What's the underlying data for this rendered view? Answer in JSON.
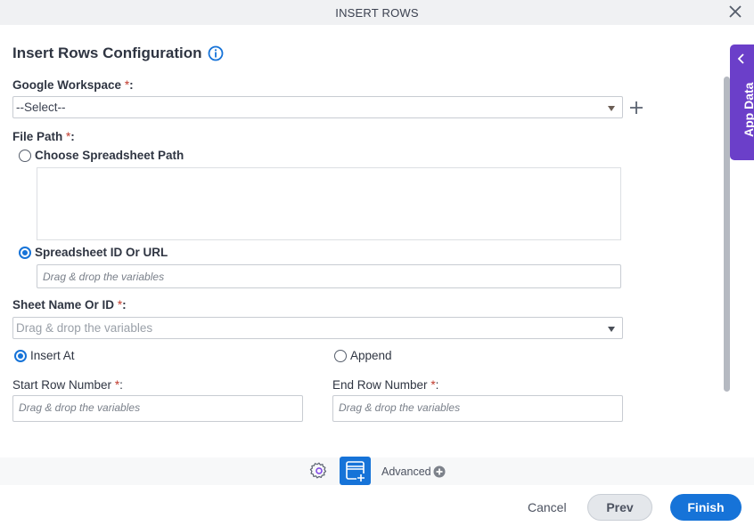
{
  "window": {
    "title": "INSERT ROWS"
  },
  "form": {
    "heading": "Insert Rows Configuration",
    "google_workspace": {
      "label": "Google Workspace",
      "required": "*",
      "colon": ":",
      "value": "--Select--"
    },
    "file_path": {
      "label": "File Path",
      "required": "*",
      "colon": ":",
      "options": [
        {
          "label": "Choose Spreadsheet Path",
          "selected": false
        },
        {
          "label": "Spreadsheet ID Or URL",
          "selected": true
        }
      ],
      "spreadsheet_id_placeholder": "Drag & drop the variables"
    },
    "sheet_name": {
      "label": "Sheet Name Or ID",
      "required": "*",
      "colon": ":",
      "placeholder": "Drag & drop the variables"
    },
    "mode": {
      "options": [
        {
          "label": "Insert At",
          "selected": true
        },
        {
          "label": "Append",
          "selected": false
        }
      ]
    },
    "start_row": {
      "label": "Start Row Number",
      "required": "*",
      "colon": ":",
      "placeholder": "Drag & drop the variables"
    },
    "end_row": {
      "label": "End Row Number",
      "required": "*",
      "colon": ":",
      "placeholder": "Drag & drop the variables"
    }
  },
  "side_panel": {
    "label": "App Data",
    "color": "#6b3fc9"
  },
  "toolbar": {
    "advanced_label": "Advanced"
  },
  "footer": {
    "cancel_label": "Cancel",
    "prev_label": "Prev",
    "finish_label": "Finish",
    "accent_color": "#1673d8"
  }
}
